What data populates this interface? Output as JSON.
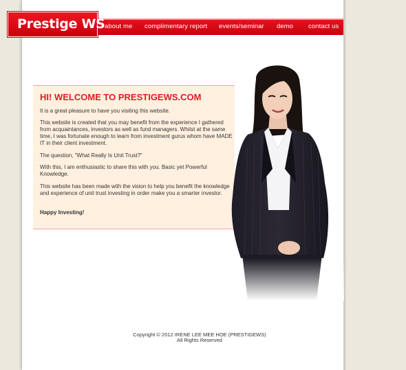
{
  "header": {
    "logo_text": "Prestige WS",
    "nav": [
      {
        "label": "about me"
      },
      {
        "label": "complimentary report"
      },
      {
        "label": "events/seminar"
      },
      {
        "label": "demo"
      },
      {
        "label": "contact us"
      }
    ]
  },
  "welcome": {
    "title": "HI! WELCOME TO PRESTIGEWS.COM",
    "paragraphs": [
      "It is a great pleasure to have you visiting this website.",
      "This website is created that you may benefit from the experience I gathered from acquaintances, investors as well as fund managers. Whilst at the same time, I was fortunate enough to learn from investment gurus whom have MADE IT in their client investment.",
      "The question, \"What Really Is Unit Trust?\"",
      "With this, I am enthusiastic to share this with you. Basic yet Powerful Knowledge.",
      "This website has been made with the vision to help you benefit the knowledge and experience of unit trust investing in order make you a smarter investor."
    ],
    "closing": "Happy Investing!"
  },
  "footer": {
    "copyright": "Copyright © 2012 IRENE LEE MEE HOE (PRESTIGEWS)",
    "rights": "All Rights Reserved"
  },
  "colors": {
    "brand_red": "#d9061a",
    "title_red": "#e01b24",
    "box_bg": "#fff0e0",
    "page_bg": "#ebe8de"
  }
}
